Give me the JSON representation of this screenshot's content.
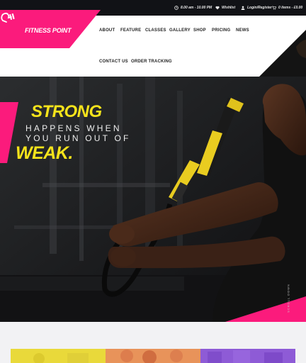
{
  "topbar": {
    "hours": "8.00 am - 10.00 PM",
    "wishlist": "Wishlist",
    "login": "Login/Register",
    "cart": "0 items - £0.00"
  },
  "brand": {
    "name": "FITNESS POINT",
    "accent": "#fb1b7c",
    "highlight": "#f5e31b"
  },
  "nav": {
    "items": [
      "ABOUT",
      "FEATURE",
      "CLASSES",
      "GALLERY",
      "SHOP",
      "PRICING",
      "NEWS",
      "CONTACT US",
      "ORDER TRACKING"
    ]
  },
  "hero": {
    "headline_top": "STRONG",
    "line1": "HAPPENS WHEN",
    "line2": "YOU RUN OUT OF",
    "headline_bottom": "WEAK.",
    "scroll_label": "SCROLL DOWN"
  }
}
